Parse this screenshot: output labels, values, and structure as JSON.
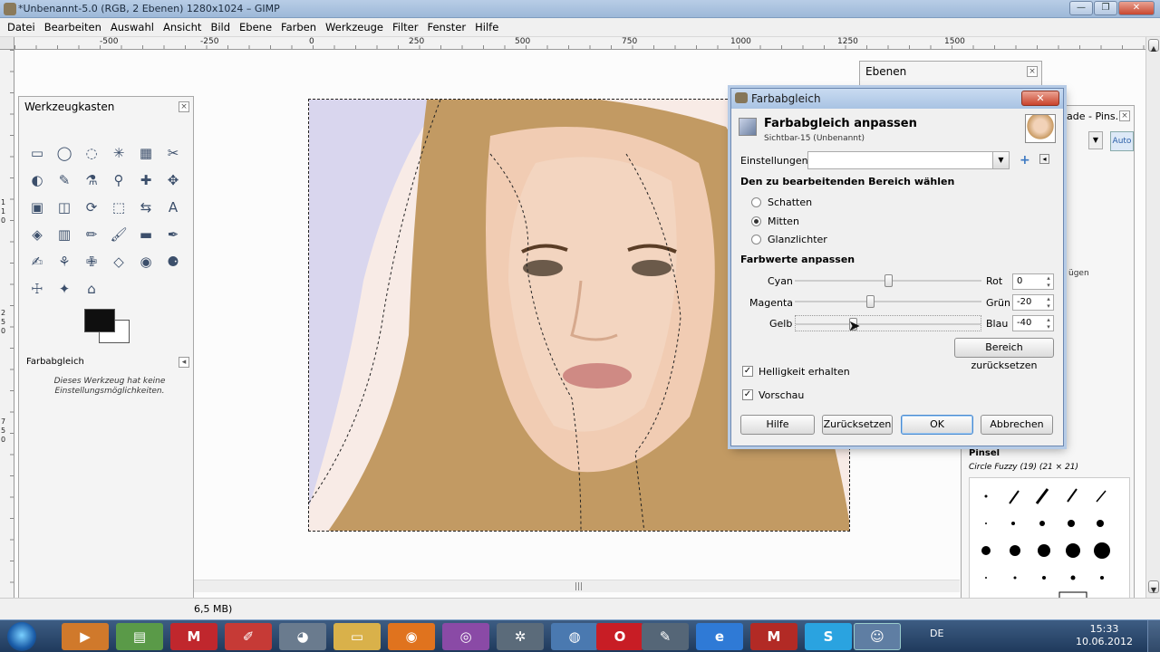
{
  "window": {
    "title": "*Unbenannt-5.0 (RGB, 2 Ebenen) 1280x1024 – GIMP",
    "min_label": "—",
    "max_label": "❐",
    "close_label": "✕"
  },
  "menu": [
    "Datei",
    "Bearbeiten",
    "Auswahl",
    "Ansicht",
    "Bild",
    "Ebene",
    "Farben",
    "Werkzeuge",
    "Filter",
    "Fenster",
    "Hilfe"
  ],
  "ruler": {
    "top": [
      "-500",
      "-250",
      "0",
      "250",
      "500",
      "750",
      "1000",
      "1250",
      "1500"
    ],
    "left": [
      "1",
      "1",
      "0",
      "2",
      "5",
      "0",
      "7",
      "5",
      "0"
    ]
  },
  "toolbox": {
    "title": "Werkzeugkasten",
    "options_title": "Farbabgleich",
    "options_text": "Dieses Werkzeug hat keine Einstellungsmöglichkeiten."
  },
  "status": {
    "text": "6,5 MB)",
    "hscroll_grip": "|||"
  },
  "ebenen": {
    "title": "Ebenen"
  },
  "rightdock": {
    "tab_label": "ade - Pins...",
    "auto_label": "Auto",
    "fragment_label": "ügen",
    "pinsel_title": "Pinsel",
    "brush_name": "Circle Fuzzy (19) (21 × 21)"
  },
  "dialog": {
    "title": "Farbabgleich",
    "close_label": "✕",
    "heading": "Farbabgleich anpassen",
    "subheading": "Sichtbar-15 (Unbenannt)",
    "settings_label": "Einstellungen:",
    "settings_value": "",
    "range_title": "Den zu bearbeitenden Bereich wählen",
    "ranges": [
      {
        "label": "Schatten",
        "selected": false
      },
      {
        "label": "Mitten",
        "selected": true
      },
      {
        "label": "Glanzlichter",
        "selected": false
      }
    ],
    "adjust_title": "Farbwerte anpassen",
    "sliders": [
      {
        "left": "Cyan",
        "right": "Rot",
        "value": "0",
        "knob": 0.5
      },
      {
        "left": "Magenta",
        "right": "Grün",
        "value": "-20",
        "knob": 0.4
      },
      {
        "left": "Gelb",
        "right": "Blau",
        "value": "-40",
        "knob": 0.3
      }
    ],
    "reset_range_label": "Bereich zurücksetzen",
    "preserve_label": "Helligkeit erhalten",
    "preview_label": "Vorschau",
    "buttons": {
      "help": "Hilfe",
      "reset": "Zurücksetzen",
      "ok": "OK",
      "cancel": "Abbrechen"
    }
  },
  "taskbar": {
    "apps": [
      "M",
      "M"
    ],
    "lang": "DE",
    "time": "15:33",
    "date": "10.06.2012"
  }
}
